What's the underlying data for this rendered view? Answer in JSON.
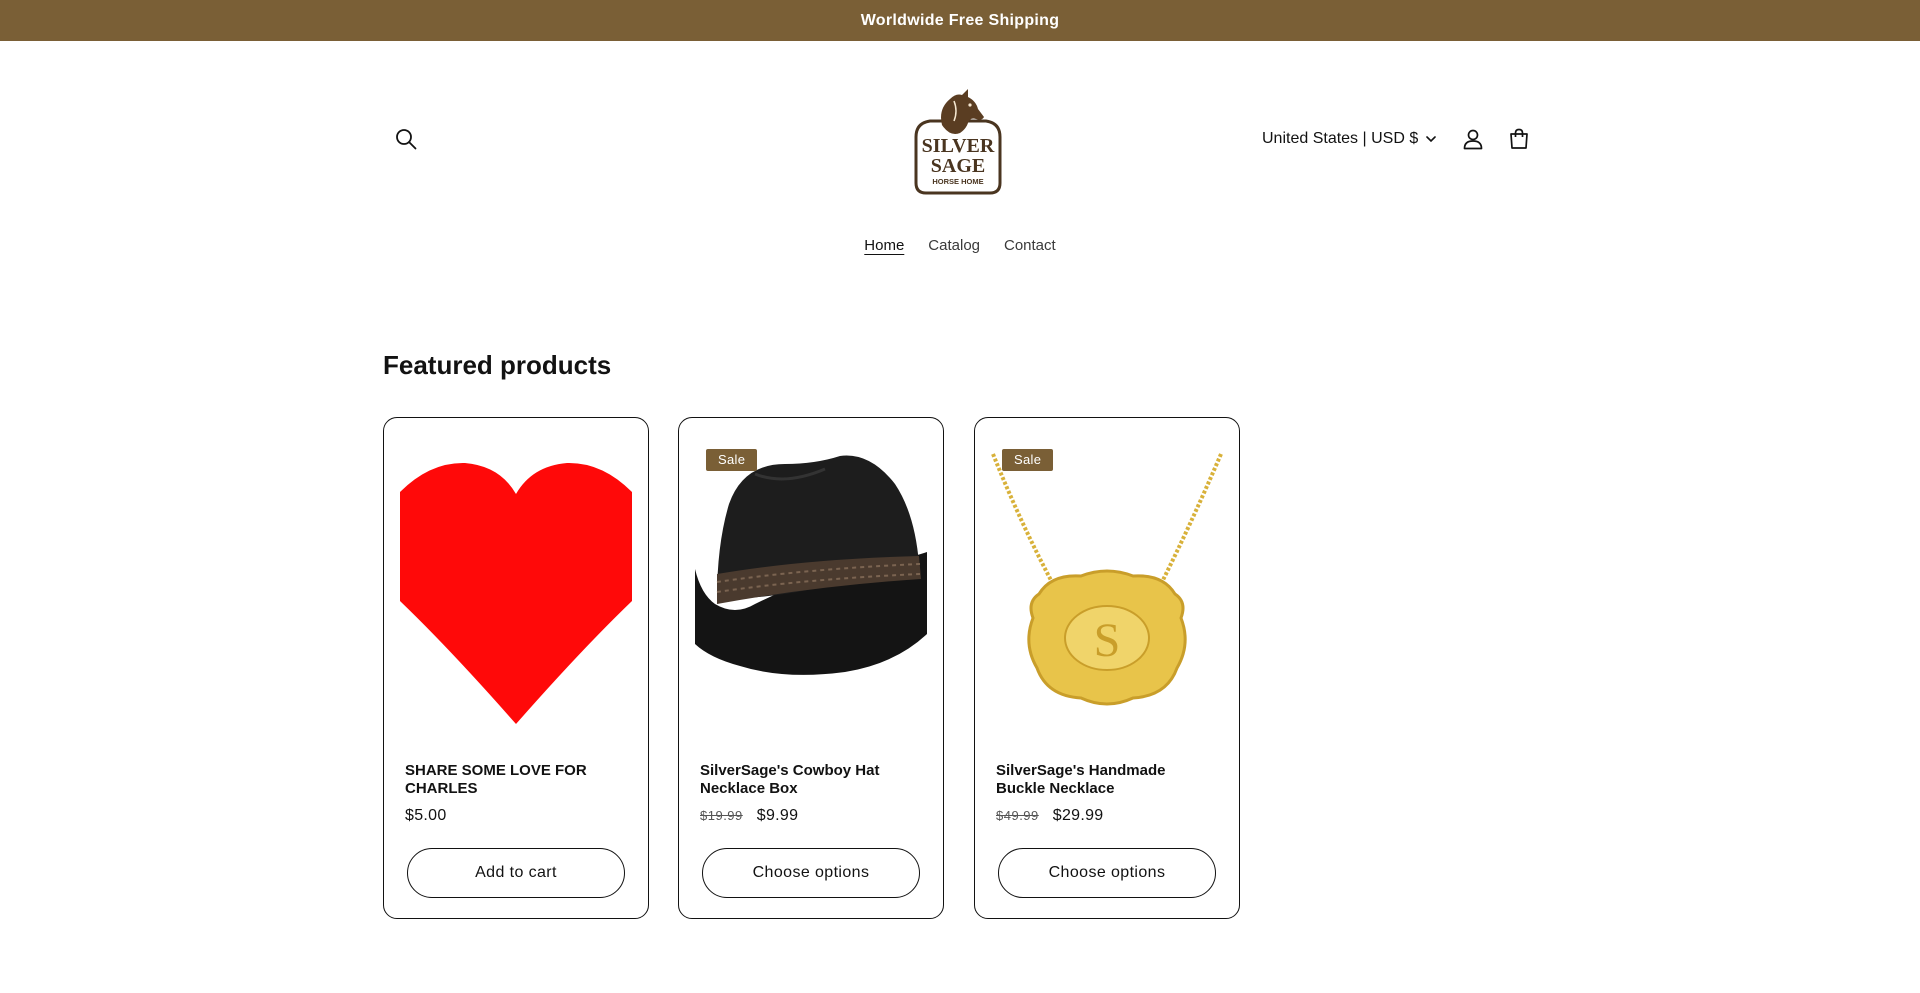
{
  "announcement": {
    "text": "Worldwide Free Shipping"
  },
  "header": {
    "logo": {
      "line1": "SILVER",
      "line2": "SAGE",
      "line3": "HORSE HOME"
    },
    "localization": "United States | USD $",
    "icons": {
      "search": "search-icon",
      "account": "user-icon",
      "cart": "cart-icon"
    }
  },
  "nav": [
    {
      "label": "Home",
      "active": true
    },
    {
      "label": "Catalog",
      "active": false
    },
    {
      "label": "Contact",
      "active": false
    }
  ],
  "featured": {
    "title": "Featured products",
    "products": [
      {
        "title": "SHARE SOME LOVE FOR CHARLES",
        "price": "$5.00",
        "compare_price": "",
        "badge": "",
        "button": "Add to cart",
        "image": "red-heart"
      },
      {
        "title": "SilverSage's Cowboy Hat Necklace Box",
        "price": "$9.99",
        "compare_price": "$19.99",
        "badge": "Sale",
        "button": "Choose options",
        "image": "black-cowboy-hat"
      },
      {
        "title": "SilverSage's Handmade Buckle Necklace",
        "price": "$29.99",
        "compare_price": "$49.99",
        "badge": "Sale",
        "button": "Choose options",
        "image": "gold-buckle-necklace"
      }
    ]
  },
  "colors": {
    "brand": "#7a5f36",
    "text": "#121212",
    "heart": "#ff0909",
    "gold": "#e8c44a"
  }
}
